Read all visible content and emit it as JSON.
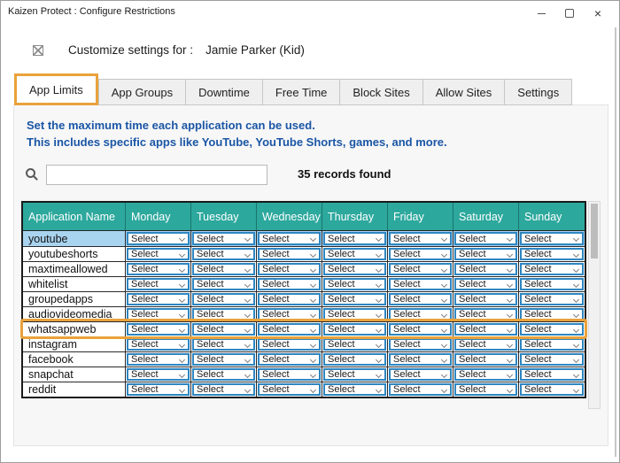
{
  "window": {
    "title": "Kaizen Protect : Configure Restrictions"
  },
  "header": {
    "customize_label": "Customize settings for :",
    "profile_name": "Jamie Parker (Kid)"
  },
  "tabs": [
    {
      "label": "App Limits",
      "active": true
    },
    {
      "label": "App Groups",
      "active": false
    },
    {
      "label": "Downtime",
      "active": false
    },
    {
      "label": "Free Time",
      "active": false
    },
    {
      "label": "Block Sites",
      "active": false
    },
    {
      "label": "Allow Sites",
      "active": false
    },
    {
      "label": "Settings",
      "active": false
    }
  ],
  "panel": {
    "description_line1": "Set the maximum time each application can be used.",
    "description_line2": "This includes specific apps like YouTube, YouTube Shorts, games, and more.",
    "search": {
      "value": "",
      "placeholder": ""
    },
    "records_found": "35 records found"
  },
  "table": {
    "columns": [
      "Application Name",
      "Monday",
      "Tuesday",
      "Wednesday",
      "Thursday",
      "Friday",
      "Saturday",
      "Sunday"
    ],
    "select_label": "Select",
    "rows": [
      {
        "app": "youtube",
        "highlighted": true,
        "annotated": false
      },
      {
        "app": "youtubeshorts",
        "highlighted": false,
        "annotated": false
      },
      {
        "app": "maxtimeallowed",
        "highlighted": false,
        "annotated": false
      },
      {
        "app": "whitelist",
        "highlighted": false,
        "annotated": false
      },
      {
        "app": "groupedapps",
        "highlighted": false,
        "annotated": false
      },
      {
        "app": "audiovideomedia",
        "highlighted": false,
        "annotated": false
      },
      {
        "app": "whatsappweb",
        "highlighted": false,
        "annotated": true
      },
      {
        "app": "instagram",
        "highlighted": false,
        "annotated": false
      },
      {
        "app": "facebook",
        "highlighted": false,
        "annotated": false
      },
      {
        "app": "snapchat",
        "highlighted": false,
        "annotated": false
      },
      {
        "app": "reddit",
        "highlighted": false,
        "annotated": false
      }
    ]
  },
  "colors": {
    "header_teal": "#2CA89D",
    "row_highlight_blue": "#A9D4F0",
    "select_border_blue": "#2E86C1",
    "annotation_orange": "#E9A23B",
    "description_blue": "#1A56A5"
  }
}
